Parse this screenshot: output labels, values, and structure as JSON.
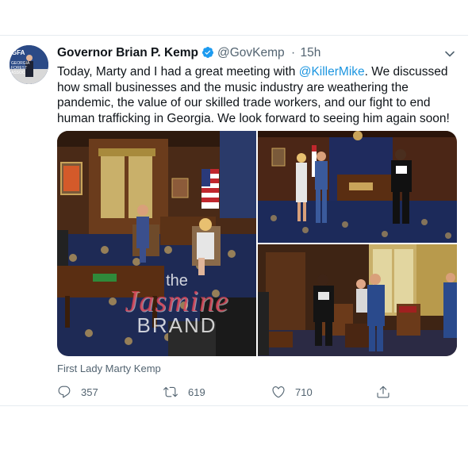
{
  "tweet": {
    "author_name": "Governor Brian P. Kemp",
    "handle": "@GovKemp",
    "separator": "·",
    "time": "15h",
    "avatar_text": [
      "GFA",
      "GEORGIA",
      "FOREST",
      "ASSOC"
    ],
    "text_parts": {
      "before": "Today, Marty and I had a great meeting with ",
      "mention": "@KillerMike",
      "after": ". We discussed how small businesses and the music industry are weathering the pandemic, the value of our skilled trade workers, and our fight to end human trafficking in Georgia. We look forward to seeing him again soon!"
    },
    "media_caption": "First Lady Marty Kemp",
    "actions": {
      "reply_count": "357",
      "retweet_count": "619",
      "like_count": "710"
    }
  },
  "watermark": {
    "line1": "the",
    "line2": "Jasmine",
    "line3": "BRAND"
  },
  "colors": {
    "accent": "#1b95e0",
    "verified": "#1d9bf0",
    "muted": "#536471"
  },
  "icons": [
    "verified-icon",
    "chevron-down-icon",
    "reply-icon",
    "retweet-icon",
    "like-icon",
    "share-icon"
  ]
}
